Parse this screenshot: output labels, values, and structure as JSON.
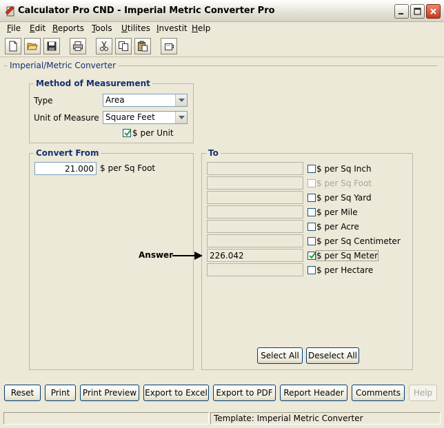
{
  "window": {
    "title": "Calculator Pro CND - Imperial Metric Converter Pro"
  },
  "menu": [
    {
      "first": "F",
      "rest": "ile"
    },
    {
      "first": "E",
      "rest": "dit"
    },
    {
      "first": "R",
      "rest": "eports"
    },
    {
      "first": "T",
      "rest": "ools"
    },
    {
      "first": "U",
      "rest": "tilites"
    },
    {
      "first": "I",
      "rest": "nvestit"
    },
    {
      "first": "H",
      "rest": "elp"
    }
  ],
  "panel": {
    "title": "Imperial/Metric Converter"
  },
  "method": {
    "title": "Method of Measurement",
    "type_label": "Type",
    "type_value": "Area",
    "unit_label": "Unit of Measure",
    "unit_value": "Square Feet",
    "per_unit_label": "$ per Unit",
    "per_unit_checked": true
  },
  "convert_from": {
    "title": "Convert From",
    "value": "21.000",
    "unit": "$ per Sq Foot"
  },
  "to": {
    "title": "To",
    "rows": [
      {
        "label": "$ per Sq Inch",
        "value": "",
        "checked": false,
        "disabled": false
      },
      {
        "label": "$ per Sq Foot",
        "value": "",
        "checked": false,
        "disabled": true
      },
      {
        "label": "$ per Sq Yard",
        "value": "",
        "checked": false,
        "disabled": false
      },
      {
        "label": "$ per Mile",
        "value": "",
        "checked": false,
        "disabled": false
      },
      {
        "label": "$ per Acre",
        "value": "",
        "checked": false,
        "disabled": false
      },
      {
        "label": "$ per Sq Centimeter",
        "value": "",
        "checked": false,
        "disabled": false
      },
      {
        "label": "$ per Sq Meter",
        "value": "226.042",
        "checked": true,
        "disabled": false
      },
      {
        "label": "$ per Hectare",
        "value": "",
        "checked": false,
        "disabled": false
      }
    ],
    "select_all": "Select All",
    "deselect_all": "Deselect All"
  },
  "annotation": {
    "label": "Answer"
  },
  "buttons": {
    "reset": "Reset",
    "print": "Print",
    "print_preview": "Print Preview",
    "export_excel": "Export to Excel",
    "export_pdf": "Export to PDF",
    "report_header": "Report Header",
    "comments": "Comments",
    "help": "Help"
  },
  "status": {
    "left": "",
    "template": "Template: Imperial Metric Converter"
  },
  "icons": [
    "calculator-app-icon",
    "minimize-icon",
    "maximize-icon",
    "close-icon",
    "new-document-icon",
    "open-folder-icon",
    "save-disk-icon",
    "printer-icon",
    "cut-scissors-icon",
    "copy-icon",
    "paste-icon",
    "calculator-tool-icon"
  ],
  "colors": {
    "accent": "#15306e",
    "close_button": "#c8361b"
  }
}
